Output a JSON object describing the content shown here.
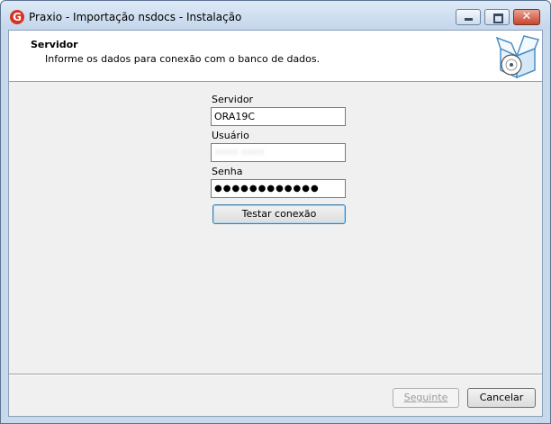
{
  "window": {
    "title": "Praxio - Importação nsdocs - Instalação",
    "app_icon_letter": "G"
  },
  "header": {
    "title": "Servidor",
    "subtitle": "Informe os dados para conexão com o banco de dados."
  },
  "form": {
    "server_label": "Servidor",
    "server_value": "ORA19C",
    "user_label": "Usuário",
    "user_value": "•••• ••••",
    "password_label": "Senha",
    "password_value": "●●●●●●●●●●●●",
    "test_button": "Testar conexão"
  },
  "footer": {
    "next_button": "Seguinte",
    "cancel_button": "Cancelar"
  },
  "colors": {
    "accent": "#3c7fb1",
    "close_button": "#c8452d"
  }
}
